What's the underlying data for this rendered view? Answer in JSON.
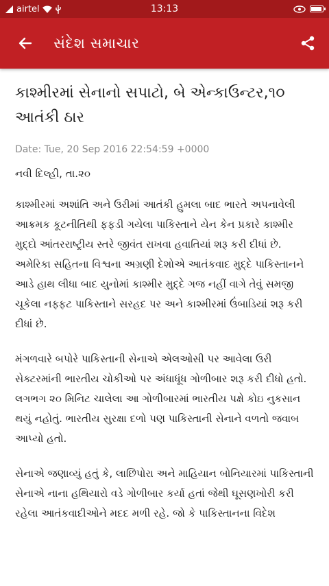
{
  "status_bar": {
    "carrier": "airtel",
    "time": "13:13",
    "battery_level": 0.95
  },
  "app_bar": {
    "title": "સંદેશ સમાચાર",
    "back_icon": "arrow-left-icon",
    "share_icon": "share-icon"
  },
  "article": {
    "headline": "કાશ્મીરમાં સેનાનો સપાટો, બે એન્કાઉન્ટર,૧૦ આતંકી ઠાર",
    "date": "Date: Tue, 20 Sep 2016 22:54:59 +0000",
    "dateline": "નવી દિલ્હી, તા.૨૦",
    "paragraphs": [
      "કાશ્મીરમાં અશાંતિ અને ઉરીમાં આતંકી હુમલા બાદ ભારતે અપનાવેલી આક્રમક કૂટનીતિથી ફફડી ગયેલા પાકિસ્તાને યેન કેન પ્રકારે કાશ્મીર મુદ્દો આંતરરાષ્ટ્રીય સ્તરે જીવંત રાખવા હવાતિયાં શરૂ કરી દીધાં છે. અમેરિકા સહિતના વિશ્વના અગ્રણી દેશોએ આતંકવાદ મુદ્દે પાકિસ્તાનને આડે હાથ લીધા બાદ યુનોમાં કાશ્મીર મુદ્દે ગજ નહીં વાગે તેવું સમજી ચૂકેલા નફ્ફટ પાકિસ્તાને સરહદ પર અને કાશ્મીરમાં ઉંબાડિયાં શરૂ કરી દીધાં છે.",
      "મંગળવારે બપોરે પાકિસ્તાની સેનાએ એલઓસી પર આવેલા ઉરી સેક્ટરમાંની ભારતીય ચોકીઓ પર અંધાધૂંધ ગોળીબાર શરૂ કરી દીધો હતો. લગભગ ૨૦ મિનિટ ચાલેલા આ ગોળીબારમાં ભારતીય પક્ષે કોઇ નુકસાન થયું નહોતું. ભારતીય સુરક્ષા દળો પણ પાકિસ્તાની સેનાને વળતો જવાબ આપ્યો હતો.",
      "સેનાએ જણાવ્યું હતું કે, લાછિપોરા અને માહિયાન બોનિયારમાં પાકિસ્તાની સેનાએ નાના હથિયારો વડે ગોળીબાર કર્યા હતાં જેથી ઘૂસણખોરી કરી રહેલા આતંકવાદીઓને મદદ મળી રહે. જો કે પાકિસ્તાનના વિદેશ"
    ]
  }
}
